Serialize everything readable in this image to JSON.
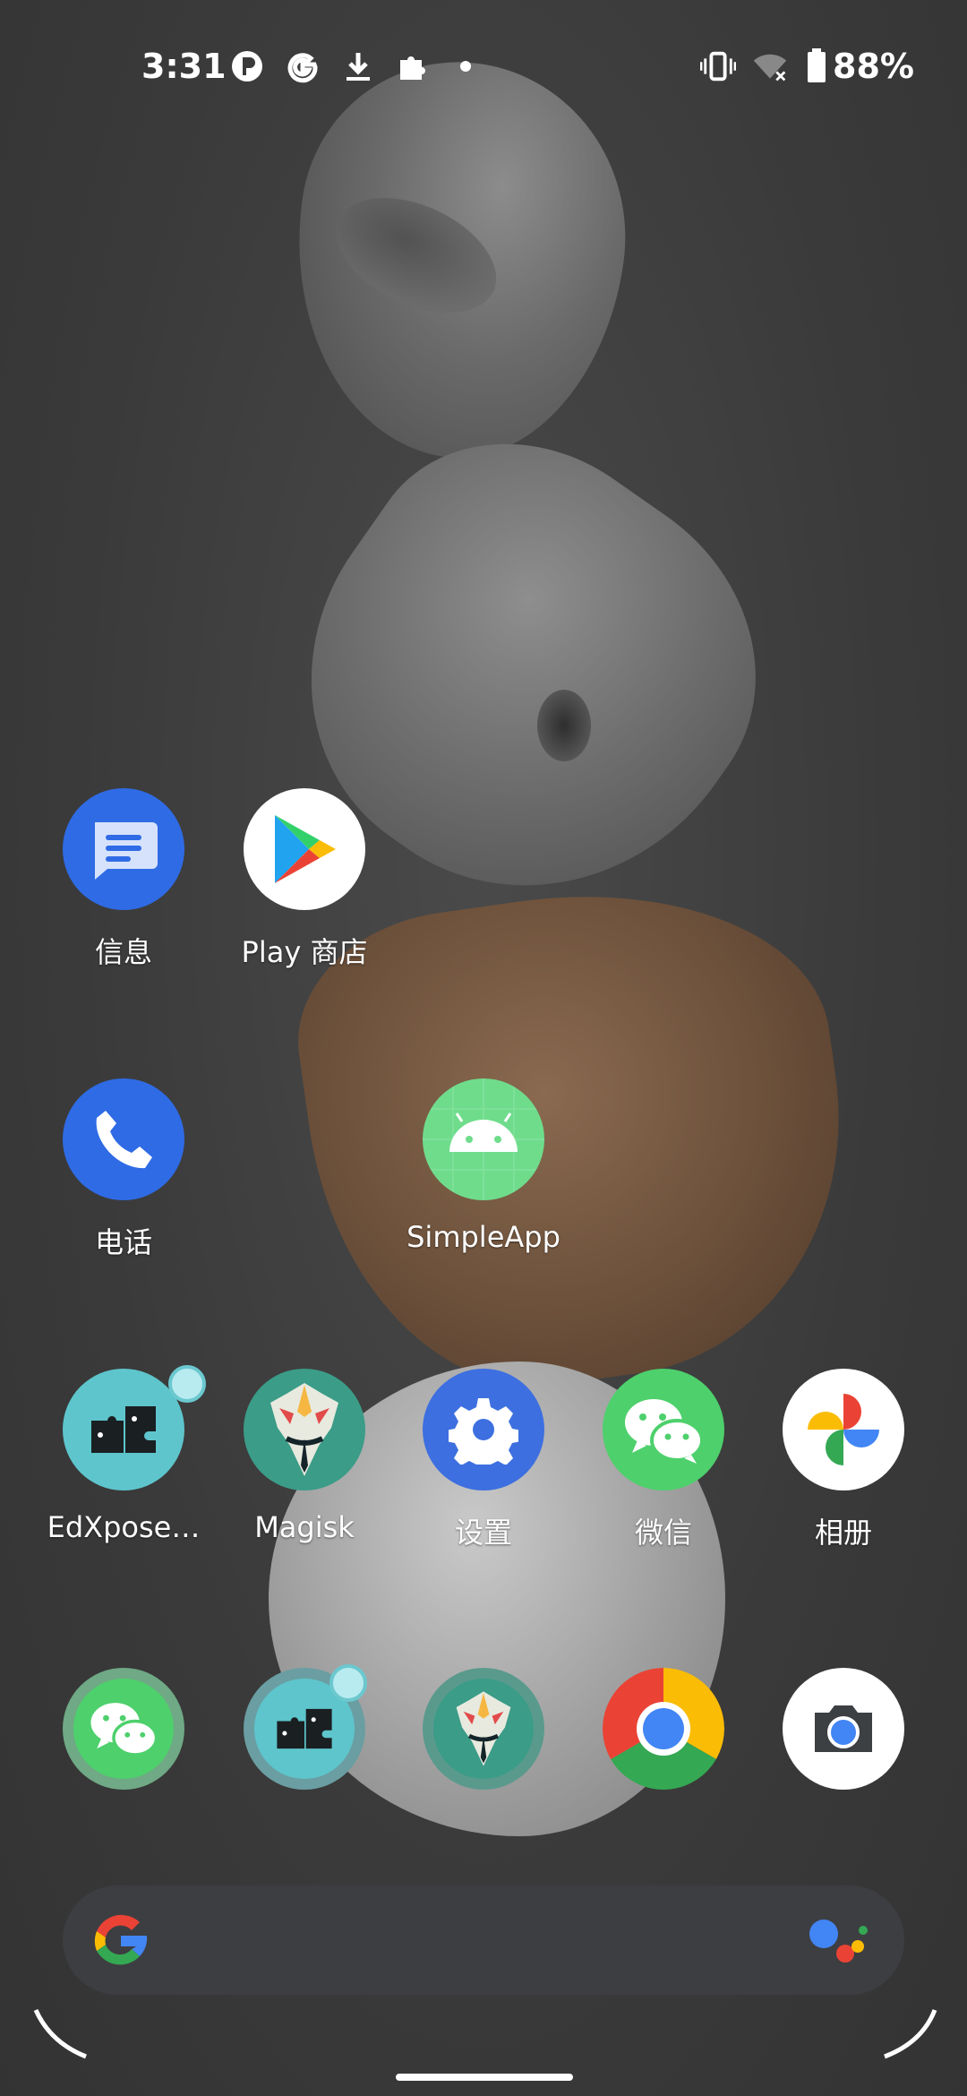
{
  "status_bar": {
    "time": "3:31",
    "battery_percent": "88%",
    "icons": [
      "pocket-icon",
      "google-icon",
      "download-icon",
      "puzzle-icon",
      "dot-icon",
      "vibrate-icon",
      "wifi-off-icon",
      "battery-icon"
    ]
  },
  "apps": {
    "messages": "信息",
    "play_store": "Play 商店",
    "phone": "电话",
    "simpleapp": "SimpleApp",
    "edxposed": "EdXpose…",
    "magisk": "Magisk",
    "settings": "设置",
    "wechat": "微信",
    "photos": "相册"
  },
  "colors": {
    "messages_blue": "#2f6be5",
    "phone_blue": "#2f6be5",
    "settings_blue": "#3d6fe0",
    "android_green": "#6fdc8c",
    "wechat_green": "#4ed06c",
    "edxposed_teal": "#5ec5cc",
    "magisk_teal": "#3b9c88"
  }
}
